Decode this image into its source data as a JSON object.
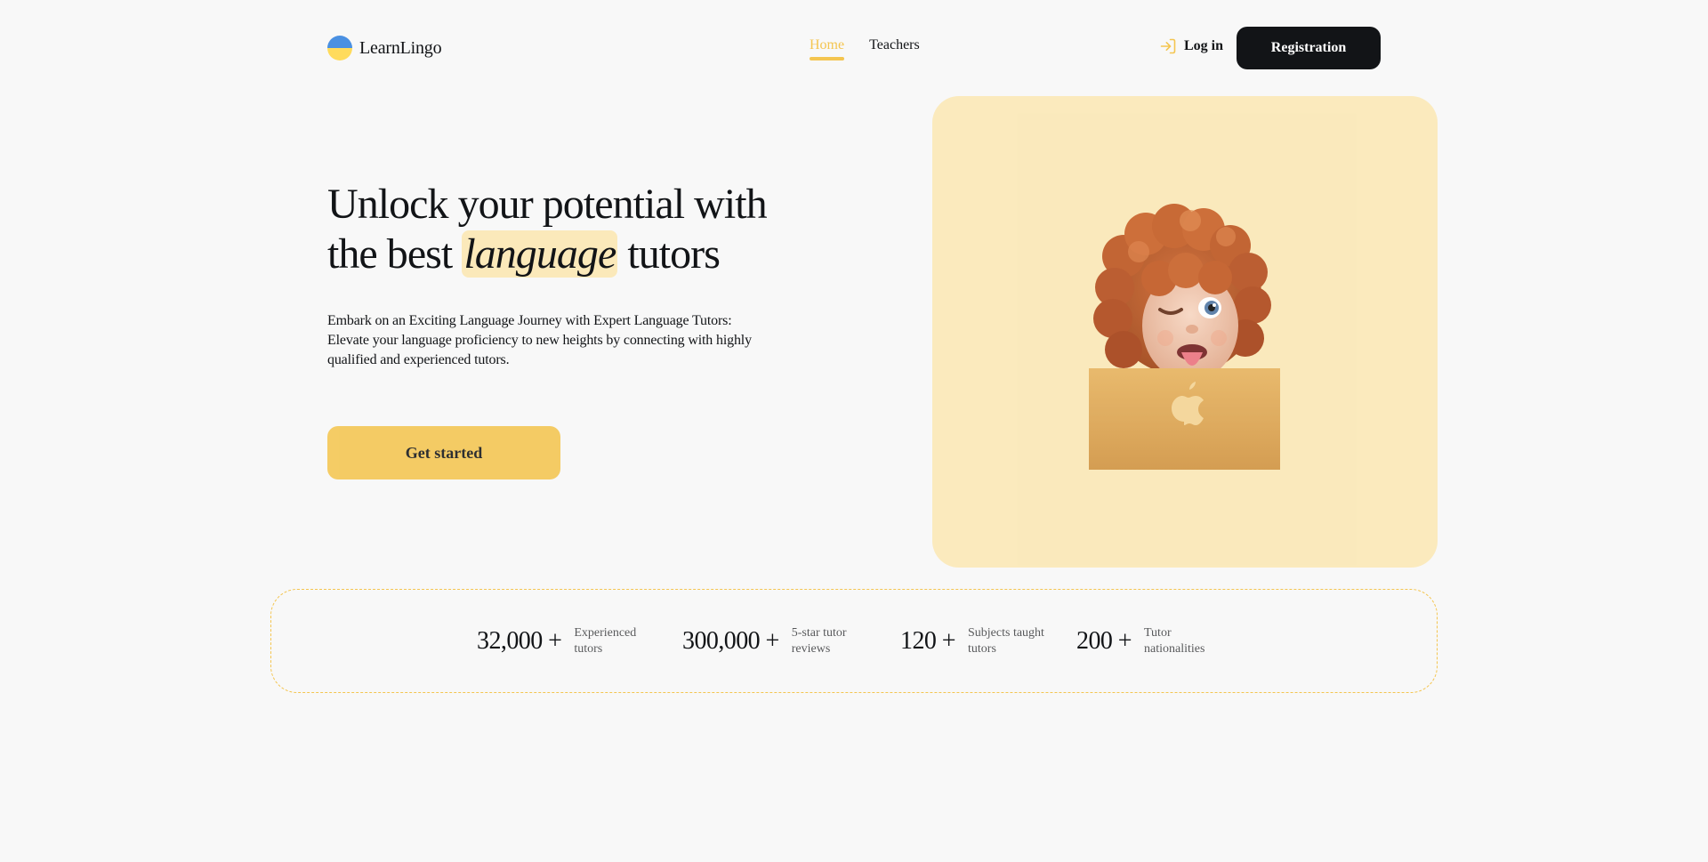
{
  "brand": {
    "name": "LearnLingo"
  },
  "nav": {
    "items": [
      {
        "label": "Home",
        "active": true
      },
      {
        "label": "Teachers",
        "active": false
      }
    ]
  },
  "auth": {
    "login_label": "Log in",
    "register_label": "Registration"
  },
  "hero": {
    "title_part1": "Unlock your potential with the best",
    "title_highlight": "language",
    "title_part2": "tutors",
    "description": "Embark on an Exciting Language Journey with Expert Language Tutors: Elevate your language proficiency to new heights by connecting with highly qualified and experienced tutors.",
    "cta_label": "Get started"
  },
  "stats": [
    {
      "value": "32,000 +",
      "label_line1": "Experienced",
      "label_line2": "tutors"
    },
    {
      "value": "300,000 +",
      "label_line1": "5-star tutor",
      "label_line2": "reviews"
    },
    {
      "value": "120 +",
      "label_line1": "Subjects taught",
      "label_line2": "tutors"
    },
    {
      "value": "200 +",
      "label_line1": "Tutor",
      "label_line2": "nationalities"
    }
  ],
  "colors": {
    "accent": "#f4c550",
    "accent_light": "#fbe9ba",
    "dark": "#121417",
    "background": "#f8f8f8",
    "flag_blue": "#4a90e2",
    "flag_yellow": "#ffdb5c"
  },
  "icons": {
    "logo": "ukraine-flag-circle-icon",
    "login": "log-in-arrow-icon",
    "device": "apple-logo-icon"
  }
}
